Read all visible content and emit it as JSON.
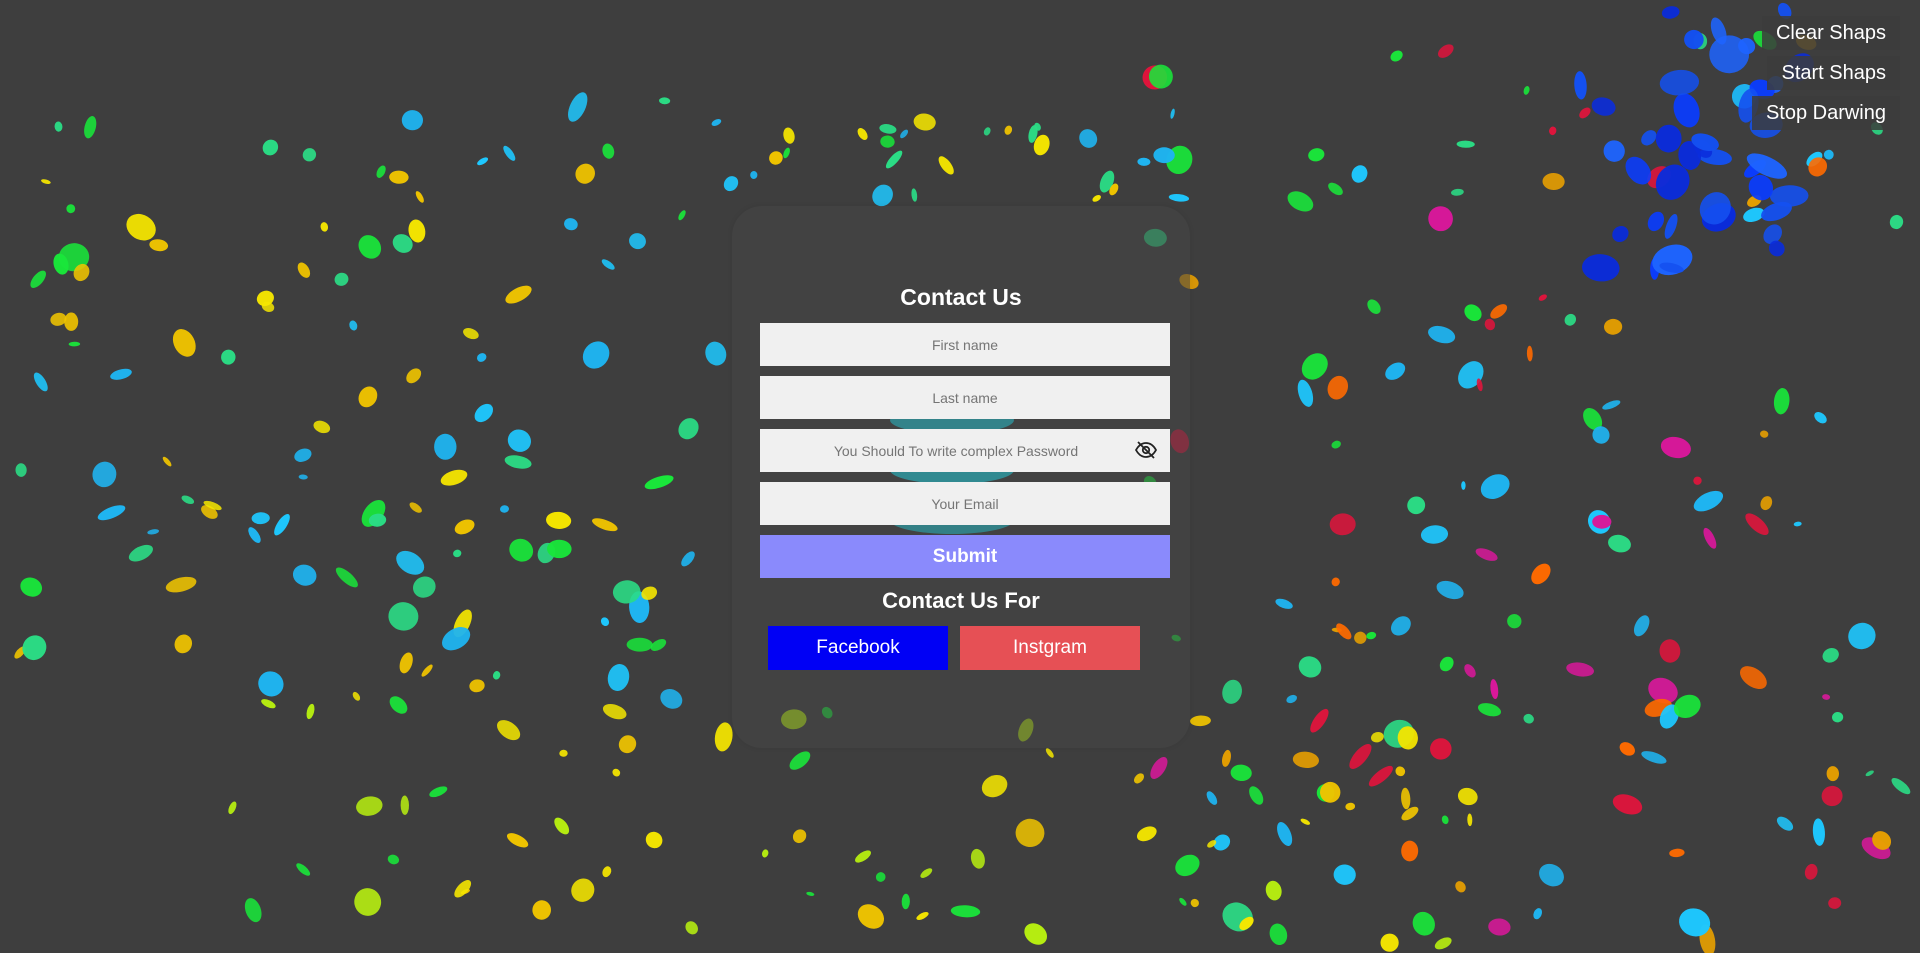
{
  "controls": {
    "clear_label": "Clear Shaps",
    "start_label": "Start Shaps",
    "stop_label": "Stop Darwing"
  },
  "form": {
    "title": "Contact Us",
    "first_name_placeholder": "First name",
    "last_name_placeholder": "Last name",
    "password_placeholder": "You Should To write complex Password",
    "email_placeholder": "Your Email",
    "submit_label": "Submit",
    "social_title": "Contact Us For",
    "facebook_label": "Facebook",
    "instagram_label": "Instgram"
  },
  "colors": {
    "background": "#3e3e3e",
    "submit": "#8a8afc",
    "facebook": "#0000f5",
    "instagram": "#e65055"
  },
  "icons": {
    "password_toggle": "eye-slash-icon"
  }
}
